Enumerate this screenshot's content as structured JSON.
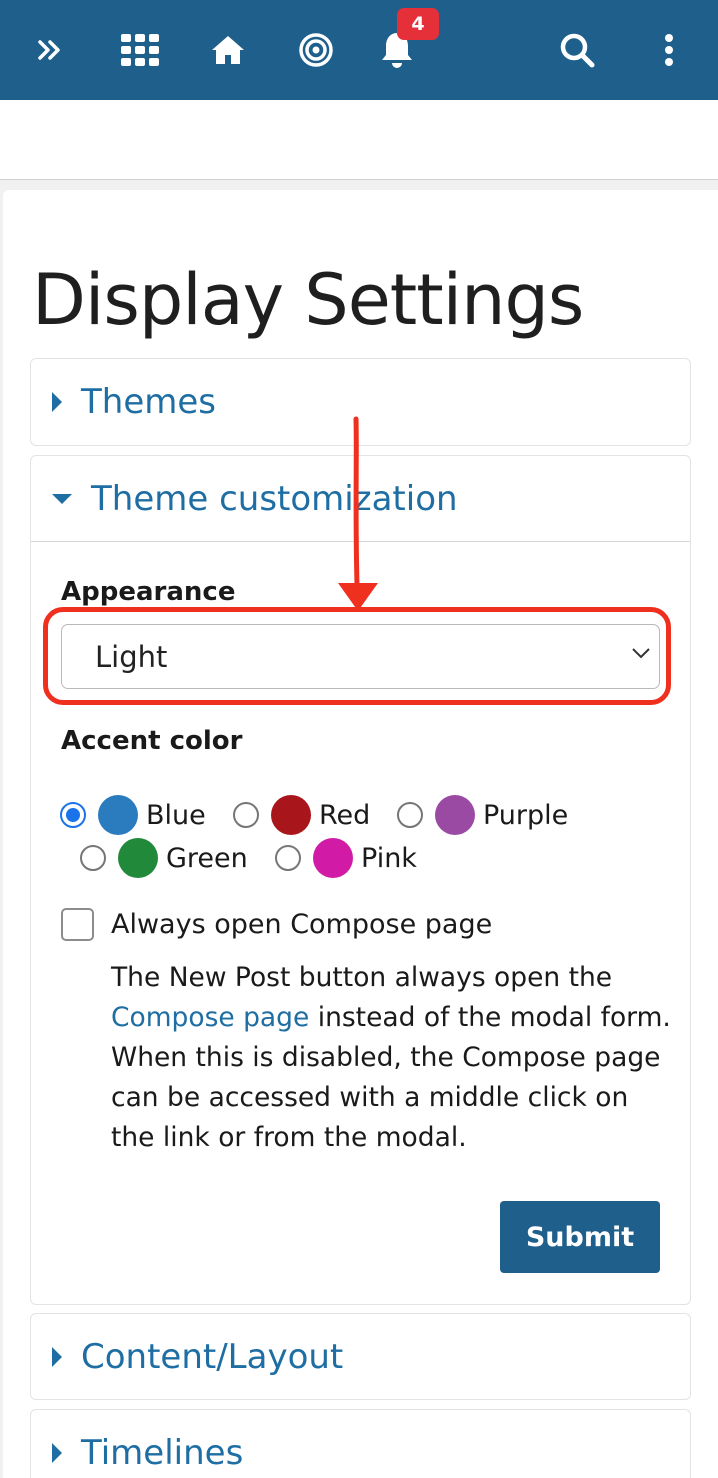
{
  "navbar": {
    "notification_count": "4",
    "icons": [
      "expand-icon",
      "apps-grid-icon",
      "home-icon",
      "target-icon",
      "bell-icon",
      "search-icon",
      "more-vertical-icon"
    ]
  },
  "page": {
    "title": "Display Settings"
  },
  "sections": {
    "themes": "Themes",
    "theme_customization": "Theme customization",
    "content_layout": "Content/Layout",
    "timelines": "Timelines"
  },
  "form": {
    "appearance_label": "Appearance",
    "appearance_value": "Light",
    "accent_label": "Accent color",
    "accents": [
      {
        "label": "Blue",
        "color": "#2b7bbf",
        "selected": true
      },
      {
        "label": "Red",
        "color": "#a8151a",
        "selected": false
      },
      {
        "label": "Purple",
        "color": "#9b4aa3",
        "selected": false
      },
      {
        "label": "Green",
        "color": "#218a3a",
        "selected": false
      },
      {
        "label": "Pink",
        "color": "#d11ba6",
        "selected": false
      }
    ],
    "compose_label": "Always open Compose page",
    "help_before": "The New Post button always open the ",
    "help_link": "Compose page",
    "help_after": " instead of the modal form. When this is disabled, the Compose page can be accessed with a middle click on the link or from the modal.",
    "submit_label": "Submit"
  },
  "colors": {
    "navbar": "#1e5f8c",
    "link": "#1e6ea3",
    "annotation": "#f0301e",
    "badge": "#e5303a"
  }
}
